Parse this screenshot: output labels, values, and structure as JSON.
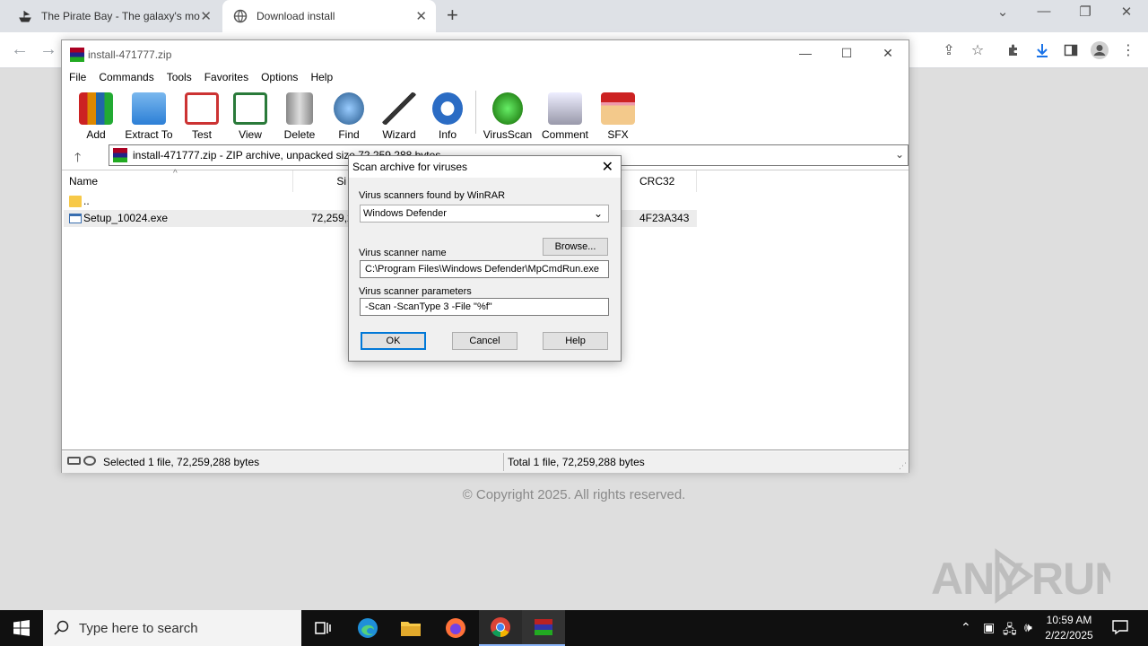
{
  "browser": {
    "tabs": [
      {
        "title": "The Pirate Bay - The galaxy's mo",
        "icon": "pirate-ship-icon"
      },
      {
        "title": "Download install",
        "icon": "globe-icon"
      }
    ]
  },
  "page": {
    "copyright": "© Copyright 2025. All rights reserved.",
    "watermark": "ANY RUN"
  },
  "winrar": {
    "title": "install-471777.zip",
    "menu": [
      "File",
      "Commands",
      "Tools",
      "Favorites",
      "Options",
      "Help"
    ],
    "tools": [
      {
        "label": "Add",
        "icon": "add-archive-icon"
      },
      {
        "label": "Extract To",
        "icon": "extract-folder-icon"
      },
      {
        "label": "Test",
        "icon": "test-clipboard-icon"
      },
      {
        "label": "View",
        "icon": "view-book-icon"
      },
      {
        "label": "Delete",
        "icon": "delete-bin-icon"
      },
      {
        "label": "Find",
        "icon": "find-magnifier-icon"
      },
      {
        "label": "Wizard",
        "icon": "wizard-wand-icon"
      },
      {
        "label": "Info",
        "icon": "info-icon"
      },
      {
        "label": "VirusScan",
        "icon": "virusscan-icon"
      },
      {
        "label": "Comment",
        "icon": "comment-icon"
      },
      {
        "label": "SFX",
        "icon": "sfx-box-icon"
      }
    ],
    "address": "install-471777.zip - ZIP archive, unpacked size 72,259,288 bytes",
    "columns": {
      "name": "Name",
      "size": "Si",
      "crc": "CRC32"
    },
    "rows": [
      {
        "name": "..",
        "size": "",
        "packed_tail": "",
        "crc": ""
      },
      {
        "name": "Setup_10024.exe",
        "size": "72,259,2",
        "packed_tail": "..",
        "crc": "4F23A343"
      }
    ],
    "status_left": "Selected 1 file, 72,259,288 bytes",
    "status_right": "Total 1 file, 72,259,288 bytes"
  },
  "dialog": {
    "title": "Scan archive for viruses",
    "scanners_label": "Virus scanners found by WinRAR",
    "scanner_selected": "Windows Defender",
    "browse": "Browse...",
    "name_label": "Virus scanner name",
    "name_value": "C:\\Program Files\\Windows Defender\\MpCmdRun.exe",
    "params_label": "Virus scanner parameters",
    "params_value": "-Scan -ScanType 3 -File \"%f\"",
    "ok": "OK",
    "cancel": "Cancel",
    "help": "Help"
  },
  "taskbar": {
    "search_placeholder": "Type here to search",
    "time": "10:59 AM",
    "date": "2/22/2025"
  }
}
